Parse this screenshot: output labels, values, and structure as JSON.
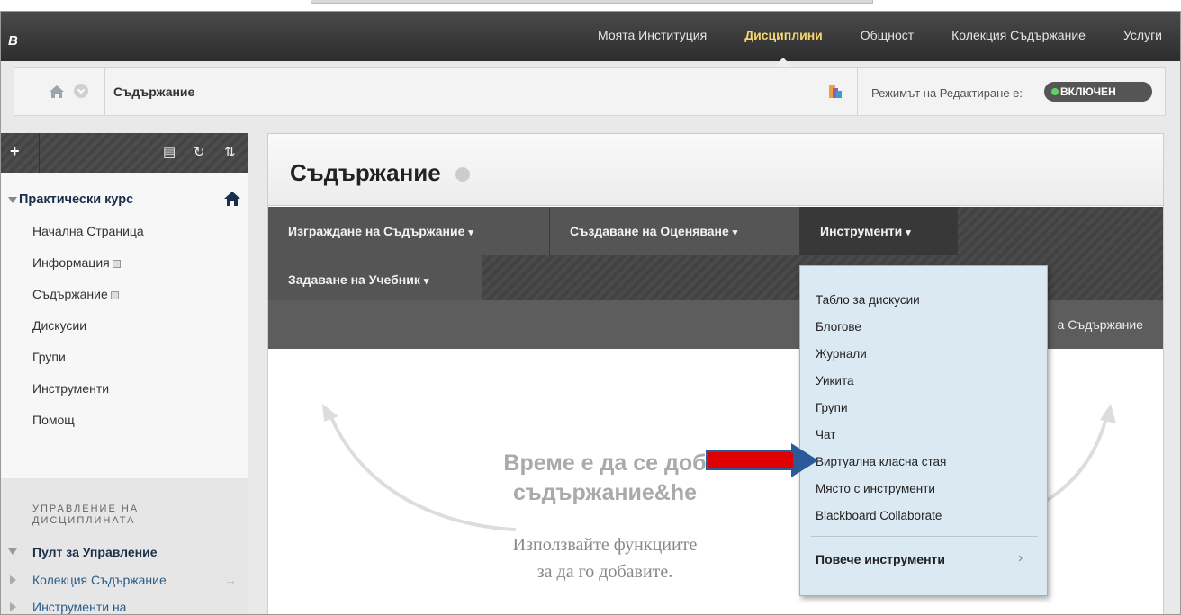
{
  "topnav": {
    "logo": "B",
    "items": [
      {
        "label": "Моята Институция"
      },
      {
        "label": "Дисциплини"
      },
      {
        "label": "Общност"
      },
      {
        "label": "Колекция Съдържание"
      },
      {
        "label": "Услуги"
      }
    ]
  },
  "breadcrumb": {
    "title": "Съдържание",
    "edit_mode_label": "Режимът на Редактиране е:",
    "edit_mode_value": "ВКЛЮЧЕН"
  },
  "sidebar": {
    "course_name": "Практически курс",
    "items": [
      {
        "label": "Начална Страница"
      },
      {
        "label": "Информация"
      },
      {
        "label": "Съдържание"
      },
      {
        "label": "Дискусии"
      },
      {
        "label": "Групи"
      },
      {
        "label": "Инструменти"
      },
      {
        "label": "Помощ"
      }
    ],
    "management_title": "УПРАВЛЕНИЕ НА ДИСЦИПЛИНАТА",
    "management_items": [
      {
        "label": "Пулт за Управление"
      },
      {
        "label": "Колекция Съдържание"
      },
      {
        "label": "Инструменти на"
      }
    ]
  },
  "content": {
    "title": "Съдържание",
    "actions": [
      {
        "label": "Изграждане на Съдържание"
      },
      {
        "label": "Създаване на Оценяване"
      },
      {
        "label": "Инструменти"
      },
      {
        "label": "Задаване на Учебник"
      }
    ],
    "subbar_text": "а Съдържание",
    "empty_title_1": "Време е да се доб",
    "empty_title_2": "съдържание&he",
    "empty_sub_1": "Използвайте функциите",
    "empty_sub_2": "за да го добавите."
  },
  "tools_menu": {
    "items": [
      {
        "label": "Табло за дискусии"
      },
      {
        "label": "Блогове"
      },
      {
        "label": "Журнали"
      },
      {
        "label": "Уикита"
      },
      {
        "label": "Групи"
      },
      {
        "label": "Чат"
      },
      {
        "label": "Виртуална класна стая"
      },
      {
        "label": "Място с инструменти"
      },
      {
        "label": "Blackboard Collaborate"
      }
    ],
    "more_label": "Повече инструменти"
  }
}
